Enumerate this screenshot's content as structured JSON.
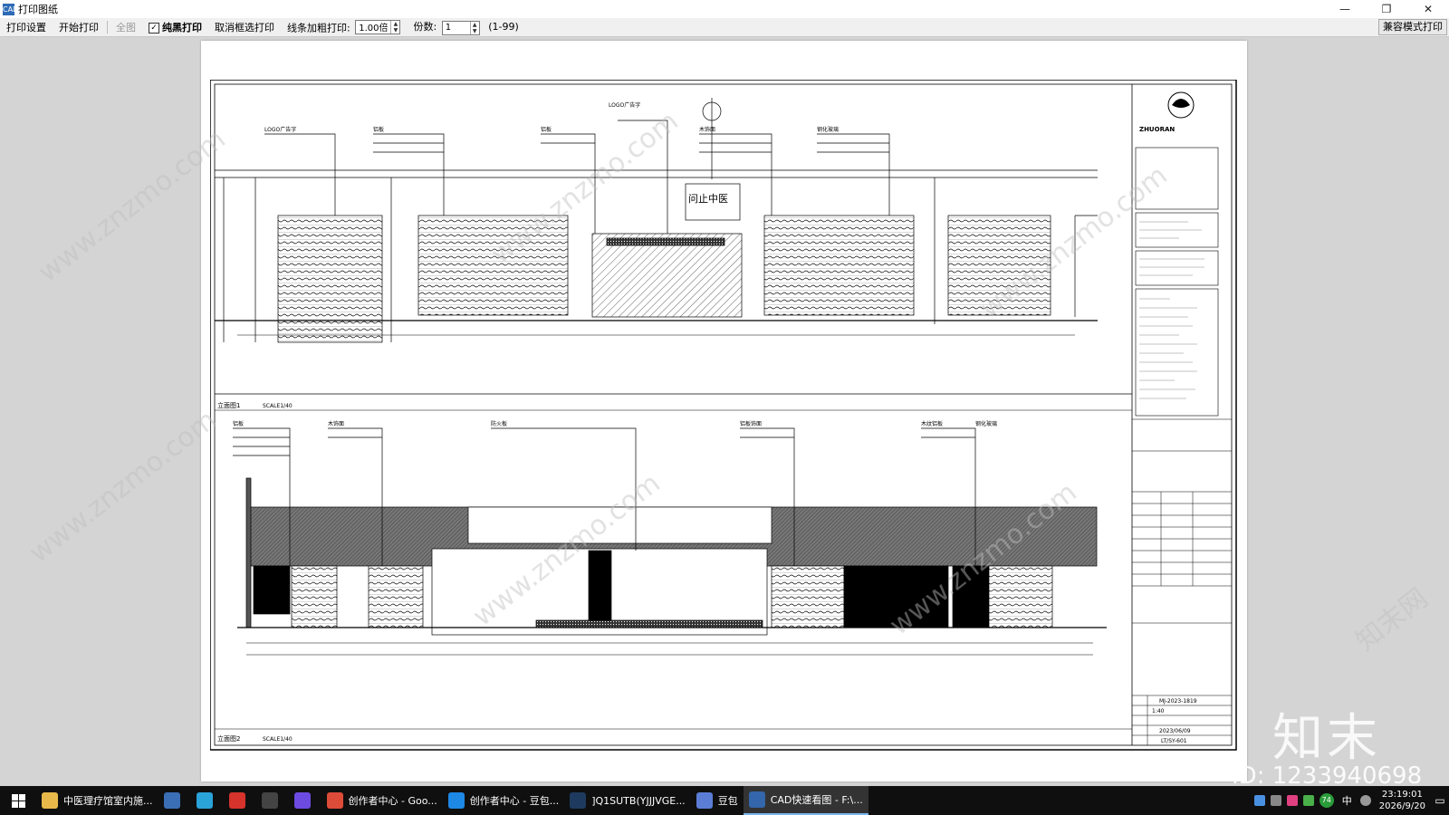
{
  "window": {
    "title": "打印图纸",
    "icon_text": "CAD",
    "minimize": "—",
    "restore": "❐",
    "close": "✕"
  },
  "toolbar": {
    "print_settings": "打印设置",
    "start_print": "开始打印",
    "full_view": "全图",
    "pure_black_checked": "✓",
    "pure_black_label": "纯黑打印",
    "cancel_select": "取消框选打印",
    "line_bold_label": "线条加粗打印:",
    "line_bold_value": "1.00倍",
    "copies_label": "份数:",
    "copies_value": "1",
    "copies_range": "(1-99)",
    "compat_mode": "兼容模式打印"
  },
  "drawing": {
    "elevation1_label": "立面图1",
    "elevation1_scale": "SCALE1/40",
    "elevation2_label": "立面图2",
    "elevation2_scale": "SCALE1/40",
    "sign_text": "问止中医",
    "company": "ZHUORAN",
    "project_no": "MJ-2023-1819",
    "date": "2023/06/09",
    "sheet_no": "LT/SY-601",
    "scale_note": "1:40",
    "annotations_top": [
      "LOGO广告字",
      "铝板",
      "LOGO广告字",
      "铝板",
      "木饰面",
      "钢化玻璃"
    ],
    "annotations_bottom": [
      "铝板",
      "木饰面",
      "防火板",
      "铝板饰面",
      "木纹铝板",
      "钢化玻璃"
    ]
  },
  "watermarks": {
    "site": "www.znzmo.com",
    "brand_cn": "知末网",
    "brand_large": "知末",
    "id_text": "ID: 1233940698"
  },
  "taskbar": {
    "apps": [
      {
        "label": "中医理疗馆室内施...",
        "icon": "folder-icon",
        "color": "#e8b84a"
      },
      {
        "label": "",
        "icon": "calculator-icon",
        "color": "#3a6fb5"
      },
      {
        "label": "",
        "icon": "edge-icon",
        "color": "#2aa3d8"
      },
      {
        "label": "",
        "icon": "acrobat-icon",
        "color": "#d6332c"
      },
      {
        "label": "",
        "icon": "znzmo-icon",
        "color": "#444"
      },
      {
        "label": "",
        "icon": "ai-icon",
        "color": "#6c4be0"
      },
      {
        "label": "创作者中心 - Goo...",
        "icon": "chrome-icon",
        "color": "#dd4b39"
      },
      {
        "label": "创作者中心 - 豆包...",
        "icon": "browser-icon",
        "color": "#1e88e5"
      },
      {
        "label": "]Q1SUTB(YJJJVGE...",
        "icon": "photoshop-icon",
        "color": "#1f3a5f"
      },
      {
        "label": "豆包",
        "icon": "doubao-icon",
        "color": "#5b7dd6"
      },
      {
        "label": "CAD快速看图 - F:\\...",
        "icon": "cad-icon",
        "color": "#3366aa",
        "active": true
      }
    ],
    "tray_battery": "74",
    "ime": "中",
    "time": "23:19:01",
    "date": "2026/9/20"
  }
}
